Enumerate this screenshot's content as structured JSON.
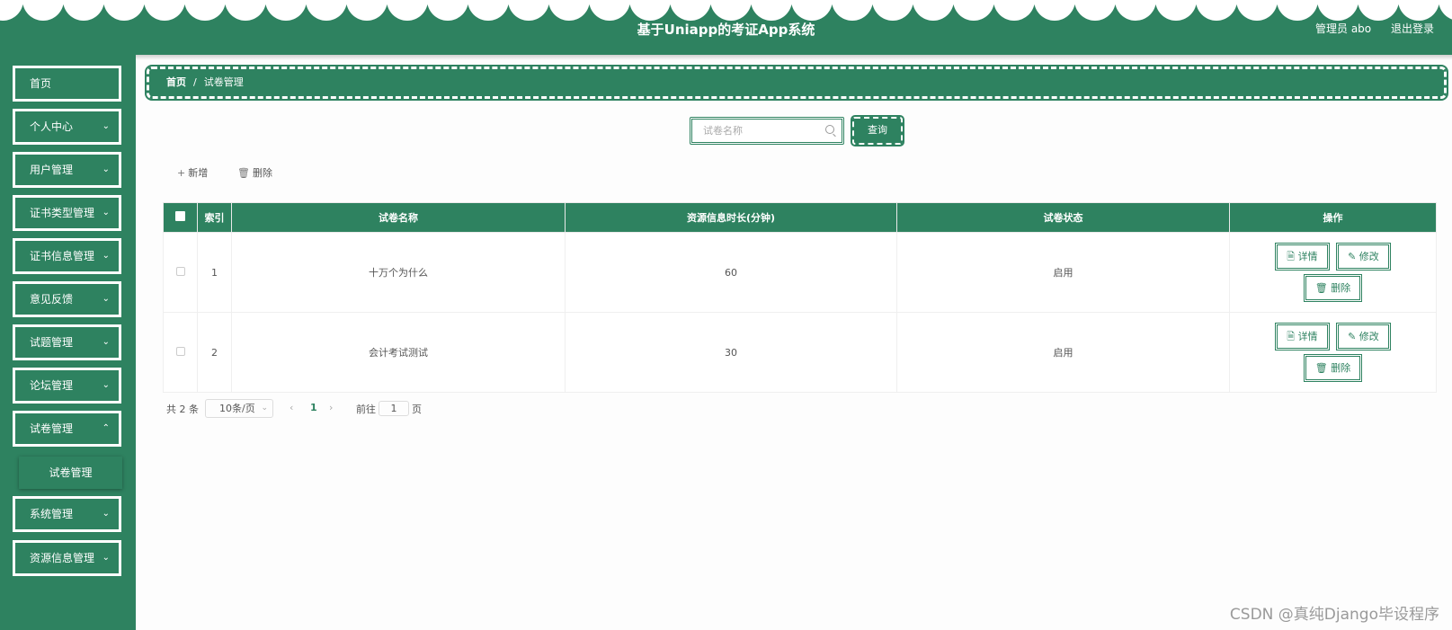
{
  "header": {
    "title": "基于Uniapp的考证App系统",
    "user_label": "管理员 abo",
    "logout_label": "退出登录"
  },
  "sidebar": {
    "items": [
      {
        "label": "首页",
        "has_chevron": false
      },
      {
        "label": "个人中心",
        "has_chevron": true
      },
      {
        "label": "用户管理",
        "has_chevron": true
      },
      {
        "label": "证书类型管理",
        "has_chevron": true
      },
      {
        "label": "证书信息管理",
        "has_chevron": true
      },
      {
        "label": "意见反馈",
        "has_chevron": true
      },
      {
        "label": "试题管理",
        "has_chevron": true
      },
      {
        "label": "论坛管理",
        "has_chevron": true
      },
      {
        "label": "试卷管理",
        "has_chevron": true
      },
      {
        "label": "系统管理",
        "has_chevron": true
      },
      {
        "label": "资源信息管理",
        "has_chevron": true
      }
    ],
    "submenu_label": "试卷管理"
  },
  "breadcrumb": {
    "home": "首页",
    "separator": "/",
    "current": "试卷管理"
  },
  "search": {
    "placeholder": "试卷名称",
    "value": "",
    "query_label": "查询"
  },
  "toolbar": {
    "add_label": "新增",
    "delete_label": "删除"
  },
  "table": {
    "headers": [
      "索引",
      "试卷名称",
      "资源信息时长(分钟)",
      "试卷状态",
      "操作"
    ],
    "rows": [
      {
        "index": "1",
        "name": "十万个为什么",
        "duration": "60",
        "status": "启用"
      },
      {
        "index": "2",
        "name": "会计考试测试",
        "duration": "30",
        "status": "启用"
      }
    ],
    "actions": {
      "detail": "详情",
      "edit": "修改",
      "delete": "删除"
    }
  },
  "pagination": {
    "total_prefix": "共",
    "total": "2",
    "total_suffix": "条",
    "page_size": "10条/页",
    "current_page": "1",
    "goto_prefix": "前往",
    "goto_value": "1",
    "goto_suffix": "页"
  },
  "watermark": "CSDN @真纯Django毕设程序",
  "colors": {
    "primary": "#2e8260",
    "background": "#fdfdfd"
  }
}
